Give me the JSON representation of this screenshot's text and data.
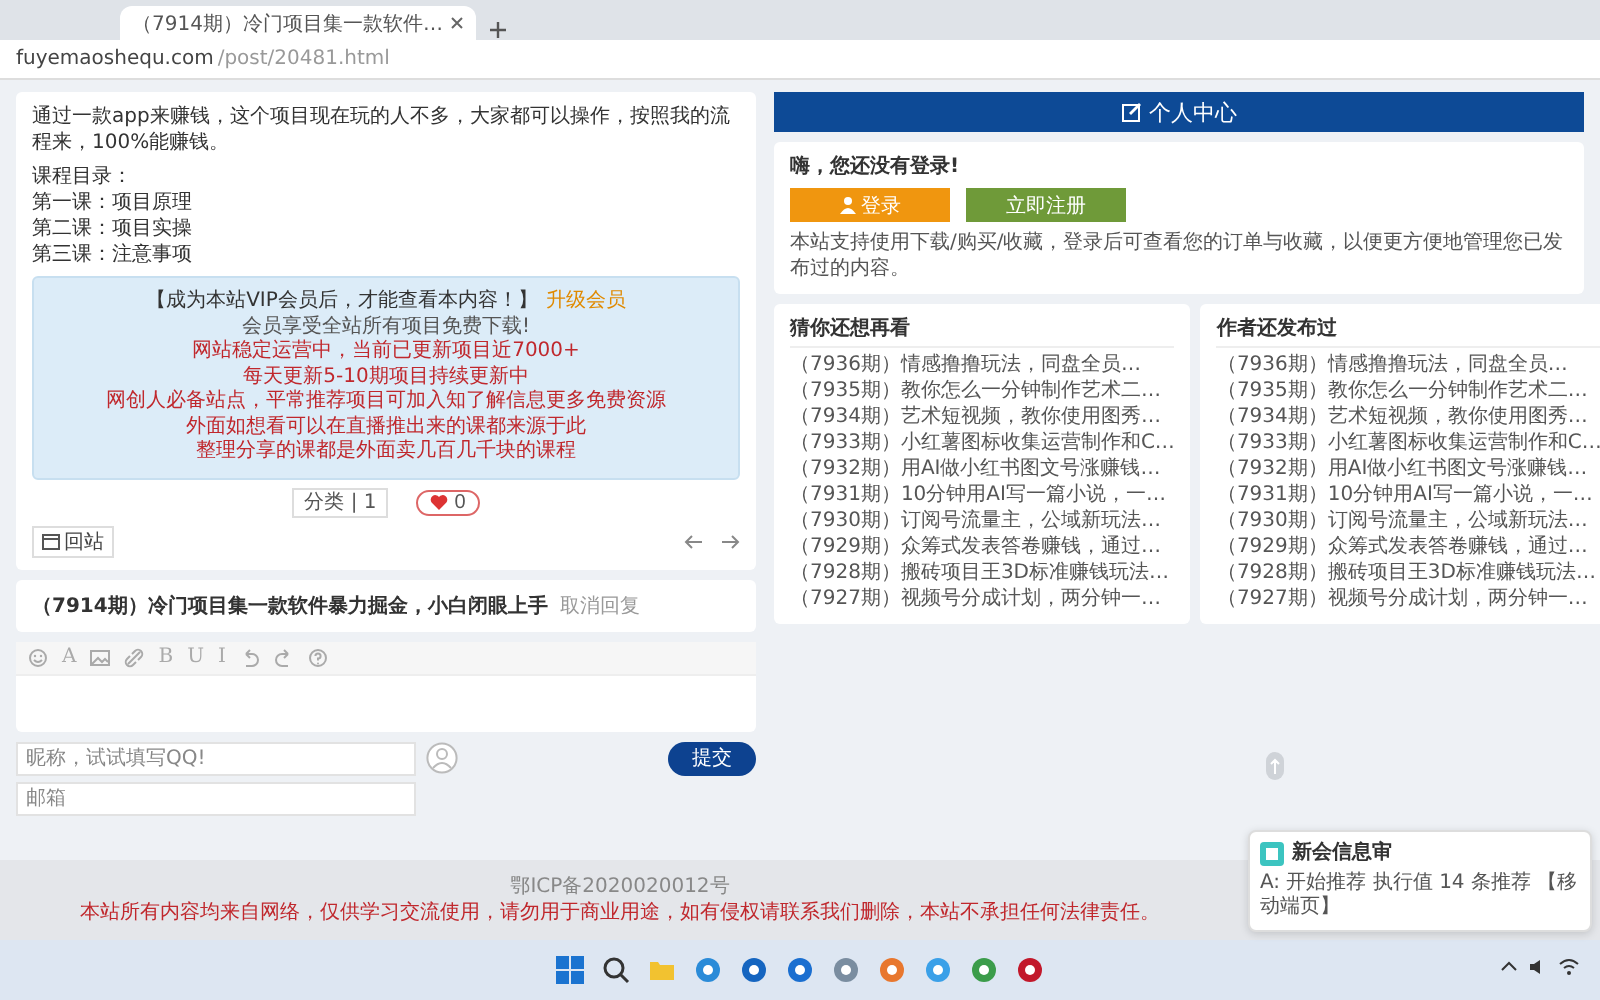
{
  "browser": {
    "tab_title": "（7914期）冷门项目集一款软件…",
    "url_host": "fuyemaoshequ.com",
    "url_path": "/post/20481.html"
  },
  "article": {
    "intro": "通过一款app来赚钱，这个项目现在玩的人不多，大家都可以操作，按照我的流程来，100%能赚钱。",
    "toc_title": "课程目录：",
    "toc": [
      "第一课：项目原理",
      "第二课：项目实操",
      "第三课：注意事项"
    ],
    "vip_box": {
      "prompt": "【成为本站VIP会员后，才能查看本内容！】",
      "upgrade_link": "升级会员",
      "lines": [
        {
          "text": "会员享受全站所有项目免费下载!",
          "kind": "note"
        },
        {
          "text": "网站稳定运营中，当前已更新项目近7000+",
          "kind": "alert"
        },
        {
          "text": "每天更新5-10期项目持续更新中",
          "kind": "alert"
        },
        {
          "text": "网创人必备站点，平常推荐项目可加入知了解信息更多免费资源",
          "kind": "alert"
        },
        {
          "text": "外面如想看可以在直播推出来的课都来源于此",
          "kind": "alert"
        },
        {
          "text": "整理分享的课都是外面卖几百几千块的课程",
          "kind": "alert"
        }
      ]
    },
    "tag": "分类 | 1",
    "like_count": "0",
    "back_label": "回站"
  },
  "comment": {
    "post_title": "（7914期）冷门项目集一款软件暴力掘金，小白闭眼上手",
    "cancel_link": "取消回复",
    "toolbar": [
      {
        "kind": "emoji"
      },
      {
        "kind": "text",
        "label": "A"
      },
      {
        "kind": "image"
      },
      {
        "kind": "link"
      },
      {
        "kind": "text",
        "label": "B"
      },
      {
        "kind": "text",
        "label": "U"
      },
      {
        "kind": "text",
        "label": "I"
      },
      {
        "kind": "undo"
      },
      {
        "kind": "redo"
      },
      {
        "kind": "help"
      }
    ],
    "name_placeholder": "昵称，试试填写QQ!",
    "email_placeholder": "邮箱",
    "submit": "提交"
  },
  "sidebar": {
    "user_center": "个人中心",
    "login_prompt": "嗨，您还没有登录!",
    "login_button": "登录",
    "register_button": "立即注册",
    "login_note": "本站支持使用下载/购买/收藏，登录后可查看您的订单与收藏，以便更方便地管理您已发布过的内容。",
    "lists": [
      {
        "title": "猜你还想再看",
        "items": [
          "（7936期）情感撸撸玩法，同盘全员…",
          "（7935期）教你怎么一分钟制作艺术二…",
          "（7934期）艺术短视频，教你使用图秀…",
          "（7933期）小红薯图标收集运营制作和C…",
          "（7932期）用AI做小红书图文号涨赚钱…",
          "（7931期）10分钟用AI写一篇小说，一…",
          "（7930期）订阅号流量主，公域新玩法…",
          "（7929期）众筹式发表答卷赚钱，通过…",
          "（7928期）搬砖项目王3D标准赚钱玩法…",
          "（7927期）视频号分成计划，两分钟一…"
        ]
      },
      {
        "title": "作者还发布过",
        "items": [
          "（7936期）情感撸撸玩法，同盘全员…",
          "（7935期）教你怎么一分钟制作艺术二…",
          "（7934期）艺术短视频，教你使用图秀…",
          "（7933期）小红薯图标收集运营制作和C…",
          "（7932期）用AI做小红书图文号涨赚钱…",
          "（7931期）10分钟用AI写一篇小说，一…",
          "（7930期）订阅号流量主，公域新玩法…",
          "（7929期）众筹式发表答卷赚钱，通过…",
          "（7928期）搬砖项目王3D标准赚钱玩法…",
          "（7927期）视频号分成计划，两分钟一…"
        ]
      }
    ]
  },
  "footer": {
    "icp": "鄂ICP备2020020012号",
    "disclaimer": "本站所有内容均来自网络，仅供学习交流使用，请勿用于商业用途，如有侵权请联系我们删除，本站不承担任何法律责任。"
  },
  "notification": {
    "title": "新会信息审",
    "body": "A: 开始推荐 执行值 14 条推荐 【移动端页】"
  }
}
